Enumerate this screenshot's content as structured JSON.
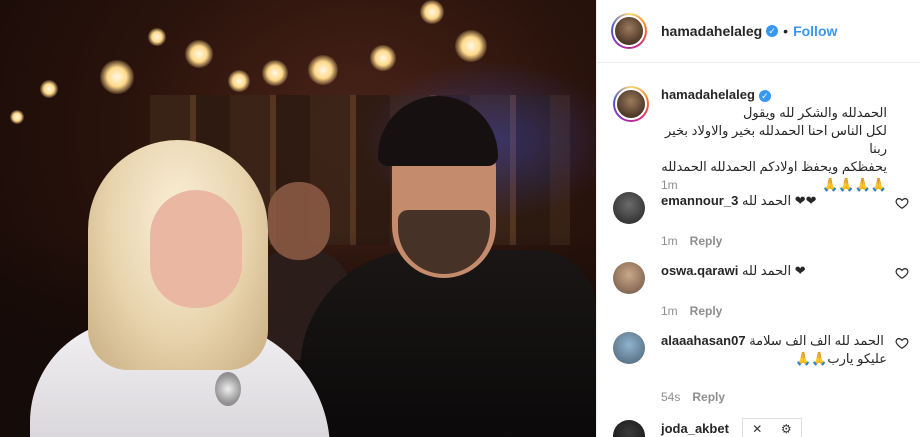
{
  "post": {
    "username": "hamadahelaleg",
    "follow_label": "Follow",
    "caption_lines": [
      "الحمدلله والشكر لله ويقول",
      "لكل الناس احنا الحمدلله بخير والاولاد بخير ربنا",
      "يحفظكم ويحفظ اولادكم الحمدلله الحمدلله🙏🙏🙏🙏"
    ],
    "caption_time": "1m"
  },
  "comments": [
    {
      "username": "emannour_3",
      "text": "الحمد لله ❤❤",
      "time": "1m",
      "reply_label": "Reply"
    },
    {
      "username": "oswa.qarawi",
      "text": "الحمد لله ❤",
      "time": "1m",
      "reply_label": "Reply"
    },
    {
      "username": "alaaahasan07",
      "text_lines": [
        "الحمد لله الف الف سلامة",
        "عليكو يارب🙏🙏"
      ],
      "time": "54s",
      "reply_label": "Reply"
    },
    {
      "username": "joda_akbet",
      "text": "..."
    }
  ],
  "icons": {
    "verified": "verified-badge-icon",
    "heart": "heart-outline-icon",
    "close": "close-icon",
    "settings": "gear-icon"
  },
  "colors": {
    "link": "#3897f0",
    "muted": "#8e8e8e",
    "text": "#262626"
  }
}
